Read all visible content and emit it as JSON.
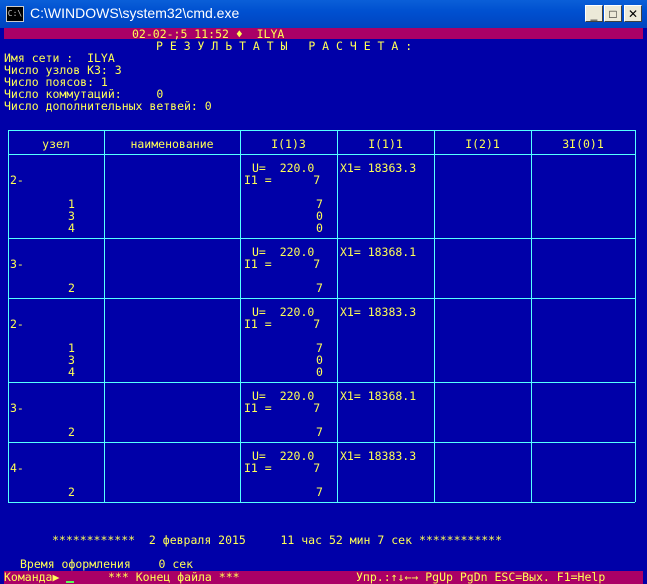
{
  "window": {
    "title": "C:\\WINDOWS\\system32\\cmd.exe",
    "icon_text": "C:\\",
    "minimize": "_",
    "maximize": "□",
    "close": "✕"
  },
  "header": {
    "date_time": "02-02-;5 11:52 ♦  ILYA",
    "title": "Р Е З У Л Ь Т А Т Ы   Р А С Ч Е Т А :"
  },
  "info": [
    "Имя сети :  ILYA",
    "Число узлов КЗ: 3",
    "Число поясов: 1",
    "Число коммутаций:     0",
    "Число дополнительных ветвей: 0"
  ],
  "table": {
    "headers": [
      "узел",
      "наименование",
      "I(1)3",
      "I(1)1",
      "I(2)1",
      "3I(0)1"
    ],
    "blocks": [
      {
        "node": "2-",
        "U": "U=  220.0",
        "I1": "I1 =      7",
        "X1": "X1= 18363.3",
        "subs": [
          "1",
          "3",
          "4"
        ],
        "vals": [
          "7",
          "0",
          "0"
        ]
      },
      {
        "node": "3-",
        "U": "U=  220.0",
        "I1": "I1 =      7",
        "X1": "X1= 18368.1",
        "subs": [
          "2"
        ],
        "vals": [
          "7"
        ]
      },
      {
        "node": "2-",
        "U": "U=  220.0",
        "I1": "I1 =      7",
        "X1": "X1= 18383.3",
        "subs": [
          "1",
          "3",
          "4"
        ],
        "vals": [
          "7",
          "0",
          "0"
        ]
      },
      {
        "node": "3-",
        "U": "U=  220.0",
        "I1": "I1 =      7",
        "X1": "X1= 18368.1",
        "subs": [
          "2"
        ],
        "vals": [
          "7"
        ]
      },
      {
        "node": "4-",
        "U": "U=  220.0",
        "I1": "I1 =      7",
        "X1": "X1= 18383.3",
        "subs": [
          "2"
        ],
        "vals": [
          "7"
        ]
      }
    ]
  },
  "footer": {
    "timestamp": "************  2 февраля 2015     11 час 52 мин 7 сек ************",
    "format_time": "Время оформления    0 сек"
  },
  "status": {
    "command": "Команда▶",
    "end_of_file": "*** Конец файла ***",
    "keys": "Упр.:↑↓←→ PgUp PgDn ESC=Вых. F1=Help"
  },
  "colors": {
    "background": "#0000a8",
    "text": "#ffff55",
    "lines": "#55ffff",
    "bars": "#aa0066",
    "titlebar": "#0050d0"
  }
}
